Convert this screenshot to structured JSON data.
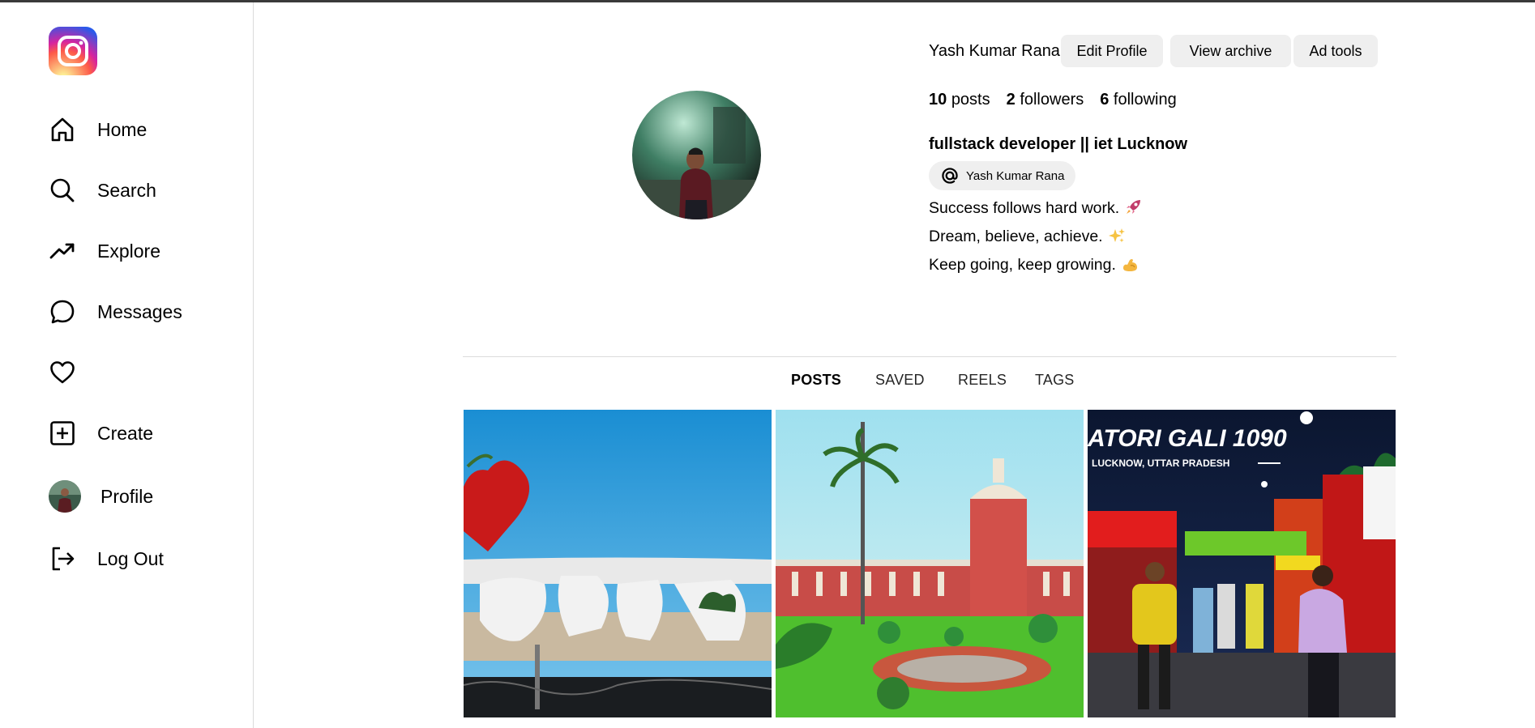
{
  "sidebar": {
    "items": [
      {
        "label": "Home",
        "icon": "home-icon"
      },
      {
        "label": "Search",
        "icon": "search-icon"
      },
      {
        "label": "Explore",
        "icon": "trending-icon"
      },
      {
        "label": "Messages",
        "icon": "message-icon"
      },
      {
        "label": "",
        "icon": "heart-icon"
      },
      {
        "label": "Create",
        "icon": "plus-square-icon"
      },
      {
        "label": "Profile",
        "icon": "avatar"
      },
      {
        "label": "Log Out",
        "icon": "logout-icon"
      }
    ]
  },
  "profile": {
    "username": "Yash Kumar Rana",
    "buttons": {
      "edit": "Edit Profile",
      "archive": "View archive",
      "ad_tools": "Ad tools"
    },
    "stats": {
      "posts_count": "10",
      "posts_label": "posts",
      "followers_count": "2",
      "followers_label": "followers",
      "following_count": "6",
      "following_label": "following"
    },
    "bio_name": "fullstack developer || iet Lucknow",
    "threads_handle": "Yash Kumar Rana",
    "bio_lines": [
      "Success follows hard work.",
      "Dream, believe, achieve.",
      "Keep going, keep growing."
    ]
  },
  "tabs": [
    "POSTS",
    "SAVED",
    "REELS",
    "TAGS"
  ],
  "active_tab": "POSTS",
  "posts": [
    {
      "name": "lucknow-sign-post",
      "overlay_text": ""
    },
    {
      "name": "charbagh-station-post",
      "overlay_text": ""
    },
    {
      "name": "chatori-gali-post",
      "overlay_text": "ATORI GALI 1090",
      "overlay_subtext": "LUCKNOW, UTTAR PRADESH"
    }
  ],
  "colors": {
    "button_bg": "#efefef",
    "divider": "#dbdbdb",
    "text": "#000000"
  }
}
